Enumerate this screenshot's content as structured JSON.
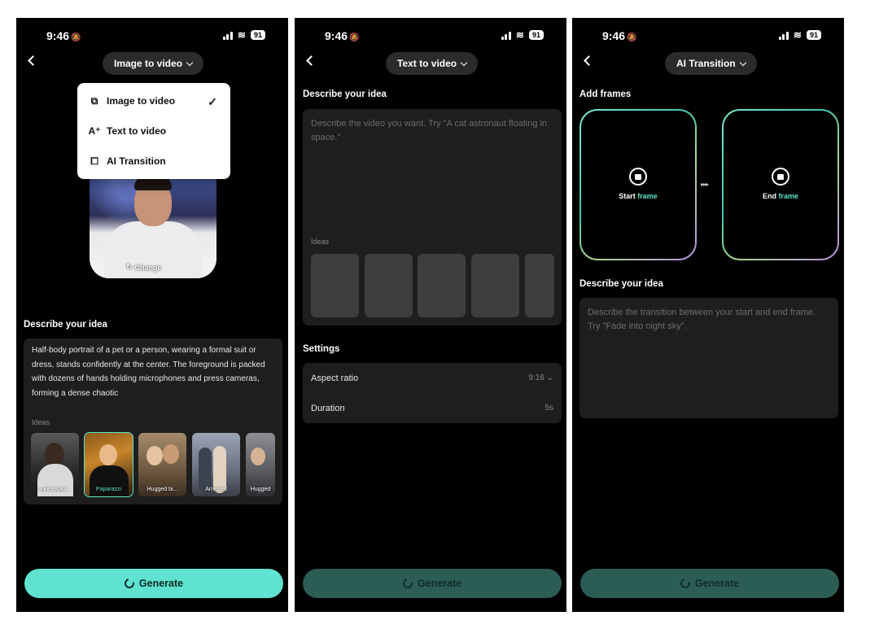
{
  "status": {
    "time": "9:46",
    "battery": "91"
  },
  "screen1": {
    "title": "Image to video",
    "dropdown": [
      {
        "label": "Image to video",
        "icon": "image-icon",
        "selected": true
      },
      {
        "label": "Text to video",
        "icon": "text-icon",
        "selected": false
      },
      {
        "label": "AI Transition",
        "icon": "transition-icon",
        "selected": false
      }
    ],
    "change_label": "Change",
    "describe_title": "Describe your idea",
    "prompt": "Half-body portrait of a pet or a person, wearing a formal suit or dress, stands confidently at the center. The foreground is packed with dozens of hands holding microphones and press cameras, forming a dense chaotic",
    "ideas_label": "Ideas",
    "ideas": [
      {
        "caption": "Fire explo...",
        "selected": false
      },
      {
        "caption": "Paparazzi",
        "selected": true
      },
      {
        "caption": "Hugged bi...",
        "selected": false
      },
      {
        "caption": "Arrested",
        "selected": false
      },
      {
        "caption": "Hugged",
        "selected": false
      }
    ],
    "generate": "Generate"
  },
  "screen2": {
    "title": "Text to video",
    "describe_title": "Describe your idea",
    "placeholder": "Describe the video you want. Try \"A cat astronaut floating in space.\"",
    "ideas_label": "Ideas",
    "settings_title": "Settings",
    "settings": [
      {
        "label": "Aspect ratio",
        "value": "9:16"
      },
      {
        "label": "Duration",
        "value": "5s"
      }
    ],
    "generate": "Generate"
  },
  "screen3": {
    "title": "AI Transition",
    "add_frames_title": "Add frames",
    "start_frame": {
      "word": "Start",
      "accent": "frame"
    },
    "end_frame": {
      "word": "End",
      "accent": "frame"
    },
    "describe_title": "Describe your idea",
    "placeholder": "Describe the transition between your start and end frame. Try \"Fade into night sky\".",
    "generate": "Generate"
  },
  "colors": {
    "accent": "#5fe3d0",
    "panel": "#1e1e1e",
    "background": "#000000"
  }
}
